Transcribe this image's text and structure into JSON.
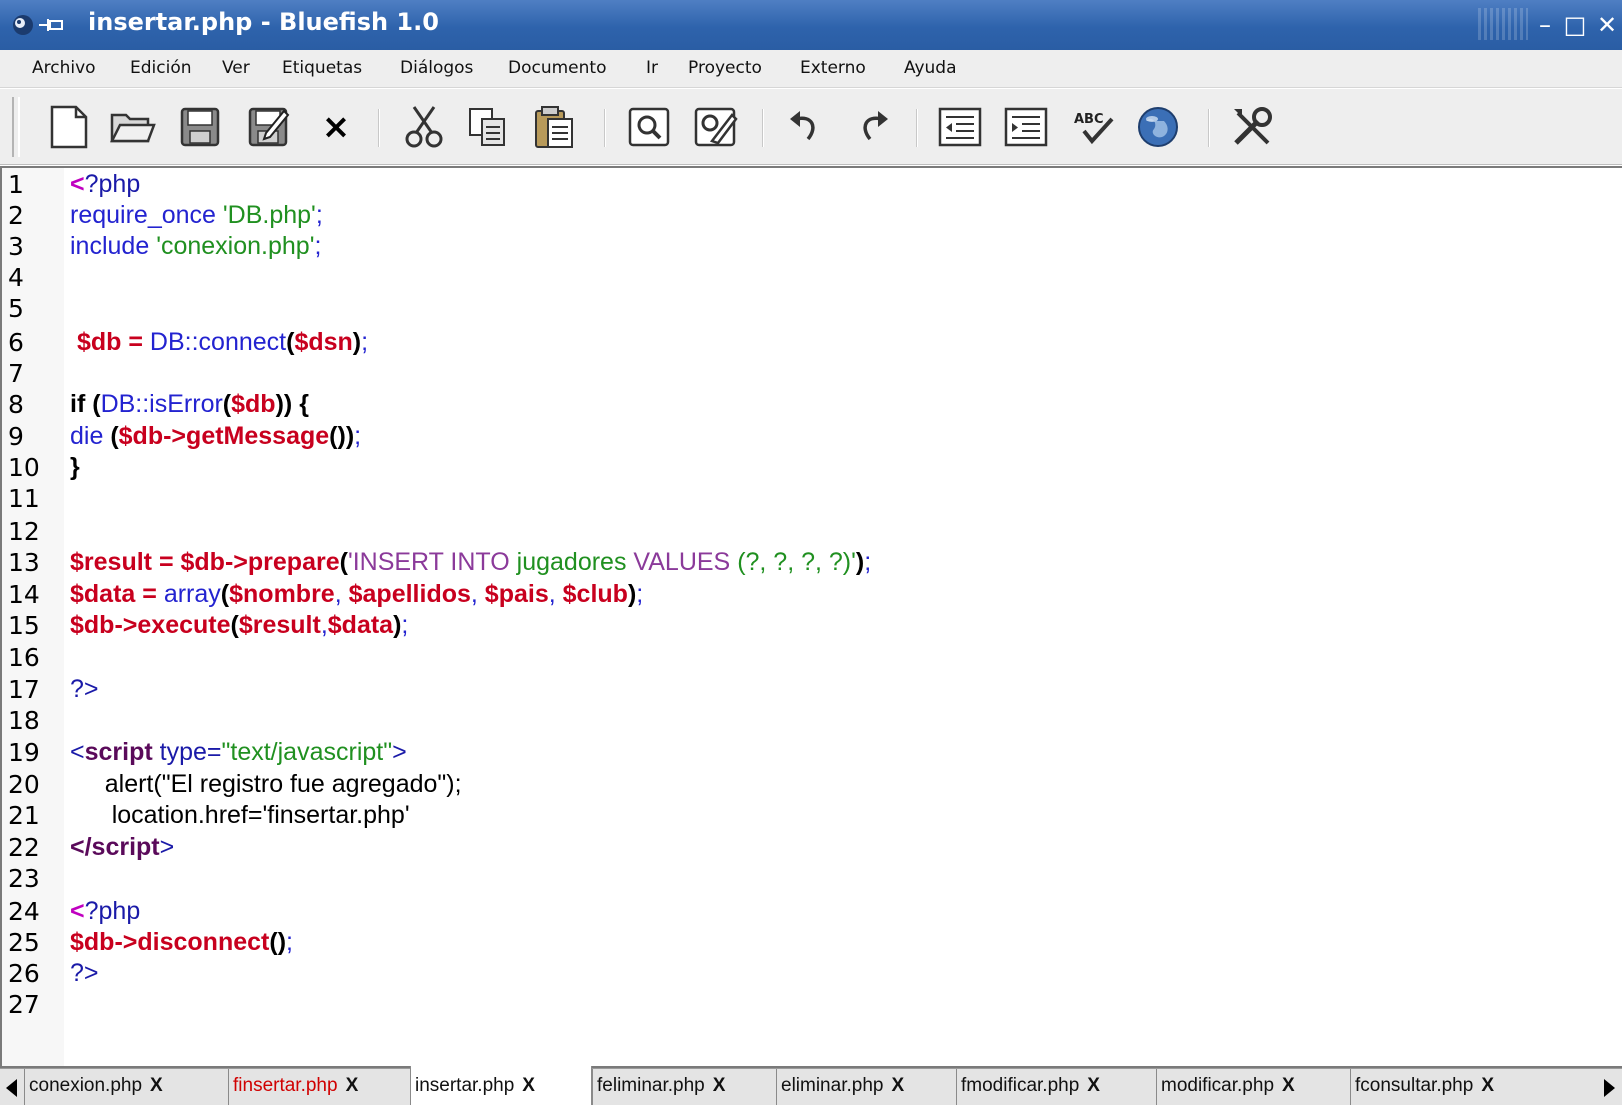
{
  "window": {
    "title": "insertar.php - Bluefish 1.0",
    "controls": {
      "minimize": "–",
      "maximize": "□",
      "close": "✕"
    }
  },
  "menubar": {
    "items": [
      "Archivo",
      "Edición",
      "Ver",
      "Etiquetas",
      "Diálogos",
      "Documento",
      "Ir",
      "Proyecto",
      "Externo",
      "Ayuda"
    ]
  },
  "toolbar": {
    "buttons": [
      "new-file",
      "open-file",
      "save",
      "save-as",
      "close-file",
      "cut",
      "copy",
      "paste",
      "find",
      "replace",
      "undo",
      "redo",
      "unindent",
      "indent",
      "spell-check",
      "preview-browser",
      "preferences"
    ],
    "close_glyph": "×"
  },
  "editor": {
    "line_numbers": [
      "1",
      "2",
      "3",
      "4",
      "5",
      "6",
      "7",
      "8",
      "9",
      "10",
      "11",
      "12",
      "13",
      "14",
      "15",
      "16",
      "17",
      "18",
      "19",
      "20",
      "21",
      "22",
      "23",
      "24",
      "25",
      "26",
      "27"
    ],
    "tokens": {
      "php_open": "?php",
      "require_once": "require_once",
      "db_php": "'DB.php'",
      "include": "include",
      "conexion_php": "'conexion.php'",
      "semi": ";",
      "db": "$db",
      "eq": "=",
      "db_connect": "DB::connect",
      "paren_open": "(",
      "paren_close": ")",
      "dsn": "$dsn",
      "if": "if",
      "is_error": "DB::isError",
      "brace_open": "{",
      "brace_close": "}",
      "die": "die",
      "arrow": "->",
      "get_message": "getMessage",
      "empty_parens": "()",
      "result": "$result",
      "prepare": "prepare",
      "sql_insert_into": "'INSERT INTO",
      "sql_table": "jugadores",
      "sql_values": "VALUES",
      "sql_params": "(?, ?, ?, ?)'",
      "data": "$data",
      "array": "array",
      "nombre": "$nombre",
      "comma": ",",
      "apellidos": "$apellidos",
      "pais": "$pais",
      "club": "$club",
      "execute": "execute",
      "php_close": "?>",
      "lt": "<",
      "gt": ">",
      "script": "script",
      "type_attr": "type=",
      "js_type": "\"text/javascript\"",
      "alert_line": "alert(\"El registro fue agregado\");",
      "location_line": "location.href='finsertar.php'",
      "close_script": "</script",
      "disconnect": "disconnect"
    }
  },
  "tabs": [
    {
      "label": "conexion.php",
      "close": "X",
      "modified": false,
      "active": false
    },
    {
      "label": "finsertar.php",
      "close": "X",
      "modified": true,
      "active": false
    },
    {
      "label": "insertar.php",
      "close": "X",
      "modified": false,
      "active": true
    },
    {
      "label": "feliminar.php",
      "close": "X",
      "modified": false,
      "active": false
    },
    {
      "label": "eliminar.php",
      "close": "X",
      "modified": false,
      "active": false
    },
    {
      "label": "fmodificar.php",
      "close": "X",
      "modified": false,
      "active": false
    },
    {
      "label": "modificar.php",
      "close": "X",
      "modified": false,
      "active": false
    },
    {
      "label": "fconsultar.php",
      "close": "X",
      "modified": false,
      "active": false
    }
  ],
  "colors": {
    "titlebar": "#2e63ac",
    "variable": "#c8001e",
    "function": "#2323d0",
    "string": "#209020",
    "sql_keyword": "#8b3a9a",
    "html_tag": "#5a0a5a",
    "modified_tab": "#d00000"
  }
}
